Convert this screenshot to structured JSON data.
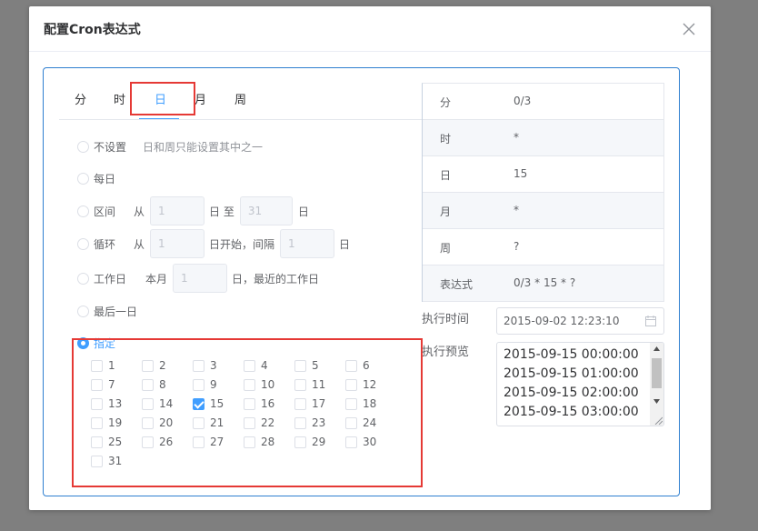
{
  "dialog": {
    "title": "配置Cron表达式"
  },
  "tabs": [
    "分",
    "时",
    "日",
    "月",
    "周"
  ],
  "options": {
    "none": {
      "label": "不设置",
      "hint": "日和周只能设置其中之一"
    },
    "every": {
      "label": "每日"
    },
    "range": {
      "label": "区间",
      "from": "从",
      "from_val": "1",
      "mid": "日 至",
      "to_val": "31",
      "end": "日"
    },
    "cycle": {
      "label": "循环",
      "from": "从",
      "start_val": "1",
      "mid": "日开始，间隔",
      "step_val": "1",
      "end": "日"
    },
    "workday": {
      "label": "工作日",
      "prefix": "本月",
      "val": "1",
      "suffix": "日，最近的工作日"
    },
    "last": {
      "label": "最后一日"
    },
    "specify": {
      "label": "指定"
    }
  },
  "days": [
    "1",
    "2",
    "3",
    "4",
    "5",
    "6",
    "7",
    "8",
    "9",
    "10",
    "11",
    "12",
    "13",
    "14",
    "15",
    "16",
    "17",
    "18",
    "19",
    "20",
    "21",
    "22",
    "23",
    "24",
    "25",
    "26",
    "27",
    "28",
    "29",
    "30",
    "31"
  ],
  "checked_days": [
    "15"
  ],
  "summary": [
    {
      "key": "分",
      "value": "0/3"
    },
    {
      "key": "时",
      "value": "*"
    },
    {
      "key": "日",
      "value": "15"
    },
    {
      "key": "月",
      "value": "*"
    },
    {
      "key": "周",
      "value": "?"
    },
    {
      "key": "表达式",
      "value": "0/3 * 15 * ?"
    }
  ],
  "exec": {
    "time_label": "执行时间",
    "time_value": "2015-09-02 12:23:10",
    "preview_label": "执行预览",
    "preview": [
      "2015-09-15 00:00:00",
      "2015-09-15 01:00:00",
      "2015-09-15 02:00:00",
      "2015-09-15 03:00:00"
    ]
  },
  "colors": {
    "accent": "#409eff",
    "highlight": "#e53935"
  }
}
